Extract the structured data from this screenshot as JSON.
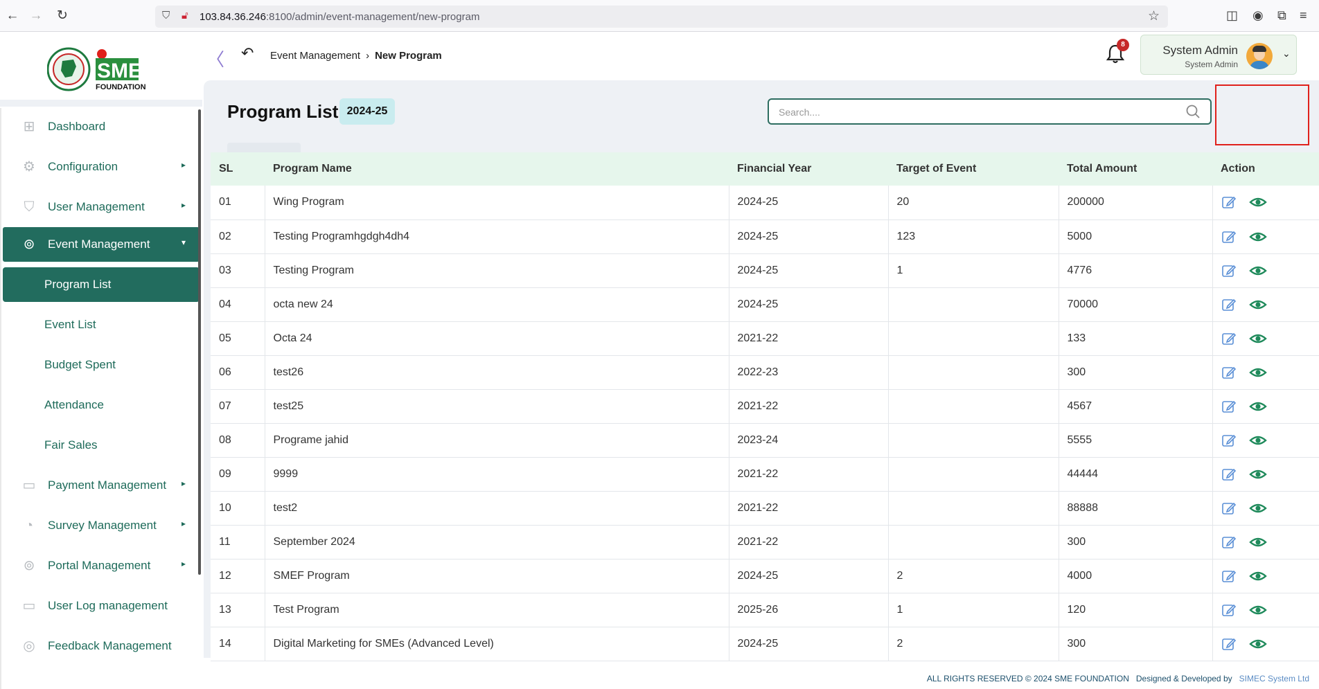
{
  "browser": {
    "url_host": "103.84.36.246",
    "url_rest": ":8100/admin/event-management/new-program"
  },
  "sidebar": {
    "logo_text": "SME",
    "logo_sub": "FOUNDATION",
    "items": [
      {
        "label": "Dashboard",
        "icon": "grid-icon",
        "arrow": false
      },
      {
        "label": "Configuration",
        "icon": "config-icon",
        "arrow": true
      },
      {
        "label": "User Management",
        "icon": "shield-icon",
        "arrow": true
      },
      {
        "label": "Event Management",
        "icon": "event-icon",
        "arrow": true,
        "active": true
      }
    ],
    "sub_items": [
      {
        "label": "Program List",
        "active": true
      },
      {
        "label": "Event List"
      },
      {
        "label": "Budget Spent"
      },
      {
        "label": "Attendance"
      },
      {
        "label": "Fair Sales"
      }
    ],
    "more_items": [
      {
        "label": "Payment Management",
        "icon": "payment-icon",
        "arrow": true
      },
      {
        "label": "Survey Management",
        "icon": "pie-icon",
        "arrow": true
      },
      {
        "label": "Portal Management",
        "icon": "lock-icon",
        "arrow": true
      },
      {
        "label": "User Log management",
        "icon": "log-icon",
        "arrow": false
      },
      {
        "label": "Feedback Management",
        "icon": "feedback-icon",
        "arrow": false
      }
    ]
  },
  "header": {
    "breadcrumb_parent": "Event Management",
    "breadcrumb_current": "New Program",
    "notification_count": "8",
    "user_name": "System Admin",
    "user_role": "System Admin"
  },
  "page": {
    "title": "Program List",
    "year_badge": "2024-25",
    "search_placeholder": "Search...."
  },
  "table": {
    "columns": [
      "SL",
      "Program Name",
      "Financial Year",
      "Target of Event",
      "Total Amount",
      "Action"
    ],
    "rows": [
      {
        "sl": "01",
        "name": "Wing Program",
        "year": "2024-25",
        "target": "20",
        "amount": "200000"
      },
      {
        "sl": "02",
        "name": "Testing Programhgdgh4dh4",
        "year": "2024-25",
        "target": "123",
        "amount": "5000"
      },
      {
        "sl": "03",
        "name": "Testing Program",
        "year": "2024-25",
        "target": "1",
        "amount": "4776"
      },
      {
        "sl": "04",
        "name": "octa new 24",
        "year": "2024-25",
        "target": "",
        "amount": "70000"
      },
      {
        "sl": "05",
        "name": "Octa 24",
        "year": "2021-22",
        "target": "",
        "amount": "133"
      },
      {
        "sl": "06",
        "name": "test26",
        "year": "2022-23",
        "target": "",
        "amount": "300"
      },
      {
        "sl": "07",
        "name": "test25",
        "year": "2021-22",
        "target": "",
        "amount": "4567"
      },
      {
        "sl": "08",
        "name": "Programe jahid",
        "year": "2023-24",
        "target": "",
        "amount": "5555"
      },
      {
        "sl": "09",
        "name": "9999",
        "year": "2021-22",
        "target": "",
        "amount": "44444"
      },
      {
        "sl": "10",
        "name": "test2",
        "year": "2021-22",
        "target": "",
        "amount": "88888"
      },
      {
        "sl": "11",
        "name": "September 2024",
        "year": "2021-22",
        "target": "",
        "amount": "300"
      },
      {
        "sl": "12",
        "name": "SMEF Program",
        "year": "2024-25",
        "target": "2",
        "amount": "4000"
      },
      {
        "sl": "13",
        "name": "Test Program",
        "year": "2025-26",
        "target": "1",
        "amount": "120"
      },
      {
        "sl": "14",
        "name": "Digital Marketing for SMEs (Advanced Level)",
        "year": "2024-25",
        "target": "2",
        "amount": "300"
      }
    ]
  },
  "footer": {
    "rights": "ALL RIGHTS RESERVED © 2024 SME FOUNDATION",
    "designed": "Designed & Developed by",
    "company": "SIMEC System Ltd"
  },
  "colors": {
    "primary": "#226c5e",
    "header_row": "#e6f6ec",
    "badge": "#c9ecef",
    "edit_icon": "#5a8fd6",
    "view_icon": "#1f8a5b"
  }
}
